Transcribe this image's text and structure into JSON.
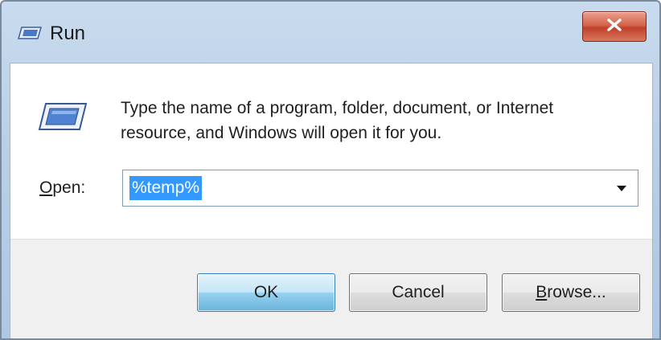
{
  "window": {
    "title": "Run",
    "icons": {
      "title": "run-window-icon",
      "close": "close-x-icon",
      "dialog": "run-program-icon",
      "dropdown": "dropdown-arrow-icon"
    }
  },
  "dialog": {
    "description_line1": "Type the name of a program, folder, document, or Internet",
    "description_line2": "resource, and Windows will open it for you.",
    "open_label_mnemonic": "O",
    "open_label_rest": "pen:",
    "open_value": "%temp%"
  },
  "buttons": {
    "ok": "OK",
    "cancel": "Cancel",
    "browse_mnemonic": "B",
    "browse_rest": "rowse..."
  },
  "colors": {
    "selection": "#3399ff",
    "close_button": "#c9503a",
    "default_button": "#98d1ef"
  }
}
